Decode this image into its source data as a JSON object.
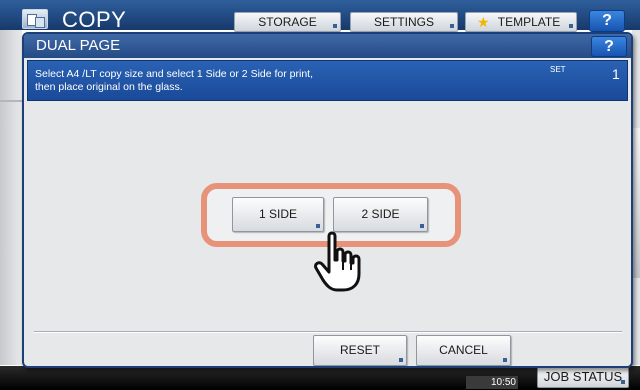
{
  "app": {
    "title": "COPY",
    "tabs": [
      {
        "label": "STORAGE"
      },
      {
        "label": "SETTINGS"
      },
      {
        "label": "TEMPLATE"
      }
    ],
    "help_label": "?"
  },
  "dialog": {
    "title": "DUAL PAGE",
    "help_label": "?",
    "message_line1": "Select A4 /LT copy size and select 1 Side or 2 Side for print,",
    "message_line2": "then place original on the glass.",
    "set_label": "SET",
    "set_count": "1",
    "options": [
      {
        "label": "1 SIDE"
      },
      {
        "label": "2 SIDE"
      }
    ],
    "reset_label": "RESET",
    "cancel_label": "CANCEL"
  },
  "status_bar": {
    "time": "10:50",
    "job_status_label": "JOB STATUS"
  },
  "icons": {
    "app": "copy-app-icon",
    "template": "star-icon",
    "pointer": "hand-cursor-icon"
  },
  "colors": {
    "header_blue": "#244b86",
    "panel_blue": "#1a4a99",
    "highlight": "#e6937a",
    "star": "#f2b500"
  }
}
